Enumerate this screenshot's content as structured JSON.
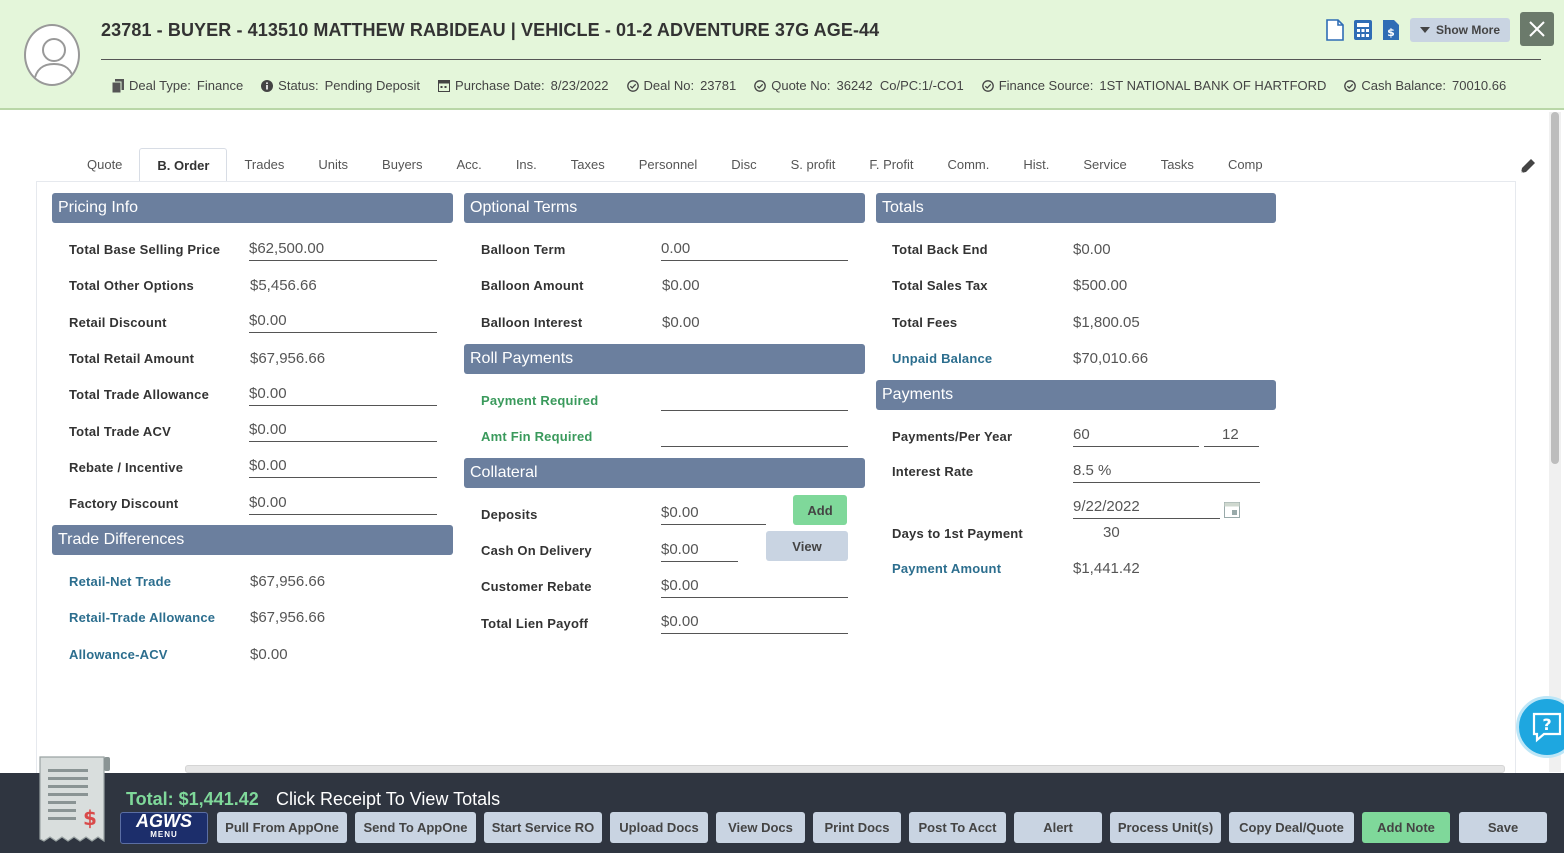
{
  "header": {
    "title": "23781 - BUYER - 413510 MATTHEW RABIDEAU | VEHICLE - 01-2 ADVENTURE 37G AGE-44",
    "show_more": "Show More",
    "meta": [
      {
        "label": "Deal Type:",
        "value": "Finance",
        "icon": "document-icon"
      },
      {
        "label": "Status:",
        "value": "Pending Deposit",
        "icon": "info-icon"
      },
      {
        "label": "Purchase Date:",
        "value": "8/23/2022",
        "icon": "calendar-icon"
      },
      {
        "label": "Deal No:",
        "value": "23781",
        "icon": "check-circle-icon"
      },
      {
        "label": "Quote No:",
        "value": "36242  Co/PC:1/-CO1",
        "icon": "check-circle-icon"
      },
      {
        "label": "Finance Source:",
        "value": "1ST NATIONAL BANK OF HARTFORD",
        "icon": "check-circle-icon"
      },
      {
        "label": "Cash Balance:",
        "value": "70010.66",
        "icon": "check-circle-icon"
      }
    ]
  },
  "tabs": [
    "Quote",
    "B. Order",
    "Trades",
    "Units",
    "Buyers",
    "Acc.",
    "Ins.",
    "Taxes",
    "Personnel",
    "Disc",
    "S. profit",
    "F. Profit",
    "Comm.",
    "Hist.",
    "Service",
    "Tasks",
    "Comp"
  ],
  "active_tab": "B. Order",
  "pricing": {
    "title": "Pricing Info",
    "rows": [
      {
        "label": "Total Base Selling Price",
        "value": "$62,500.00"
      },
      {
        "label": "Total Other Options",
        "value": "$5,456.66"
      },
      {
        "label": "Retail Discount",
        "value": "$0.00"
      },
      {
        "label": "Total Retail Amount",
        "value": "$67,956.66"
      },
      {
        "label": "Total Trade Allowance",
        "value": "$0.00"
      },
      {
        "label": "Total Trade ACV",
        "value": "$0.00"
      },
      {
        "label": "Rebate / Incentive",
        "value": "$0.00"
      },
      {
        "label": "Factory Discount",
        "value": "$0.00"
      }
    ]
  },
  "trade_diff": {
    "title": "Trade Differences",
    "rows": [
      {
        "label": "Retail-Net Trade",
        "value": "$67,956.66"
      },
      {
        "label": "Retail-Trade Allowance",
        "value": "$67,956.66"
      },
      {
        "label": "Allowance-ACV",
        "value": "$0.00"
      }
    ]
  },
  "optional": {
    "title": "Optional Terms",
    "rows": [
      {
        "label": "Balloon Term",
        "value": "0.00"
      },
      {
        "label": "Balloon Amount",
        "value": "$0.00"
      },
      {
        "label": "Balloon Interest",
        "value": "$0.00"
      }
    ]
  },
  "roll": {
    "title": "Roll Payments",
    "rows": [
      {
        "label": "Payment Required",
        "value": ""
      },
      {
        "label": "Amt Fin Required",
        "value": ""
      }
    ]
  },
  "collateral": {
    "title": "Collateral",
    "add": "Add",
    "view": "View",
    "rows": [
      {
        "label": "Deposits",
        "value": "$0.00"
      },
      {
        "label": "Cash On Delivery",
        "value": "$0.00"
      },
      {
        "label": "Customer Rebate",
        "value": "$0.00"
      },
      {
        "label": "Total Lien Payoff",
        "value": "$0.00"
      }
    ]
  },
  "totals": {
    "title": "Totals",
    "rows": [
      {
        "label": "Total Back End",
        "value": "$0.00"
      },
      {
        "label": "Total Sales Tax",
        "value": "$500.00"
      },
      {
        "label": "Total Fees",
        "value": "$1,800.05"
      },
      {
        "label": "Unpaid Balance",
        "value": "$70,010.66"
      }
    ]
  },
  "payments": {
    "title": "Payments",
    "payments_label": "Payments/Per Year",
    "payments": "60",
    "per_year": "12",
    "rate_label": "Interest Rate",
    "rate": "8.5 %",
    "date": "9/22/2022",
    "days_label": "Days to 1st Payment",
    "days": "30",
    "amount_label": "Payment Amount",
    "amount": "$1,441.42"
  },
  "footer": {
    "total": "Total: $1,441.42",
    "hint": "Click Receipt To View Totals",
    "logo": "AGWS",
    "logo_sub": "MENU",
    "buttons": [
      "Pull From AppOne",
      "Send To AppOne",
      "Start Service RO",
      "Upload Docs",
      "View Docs",
      "Print Docs",
      "Post To Acct",
      "Alert",
      "Process Unit(s)",
      "Copy Deal/Quote",
      "Add Note",
      "Save"
    ]
  },
  "colors": {
    "header_bg": "#e4f6da",
    "section_head": "#6b7f9e",
    "accent_green": "#7fd89a",
    "footer_bg": "#2f3540"
  }
}
